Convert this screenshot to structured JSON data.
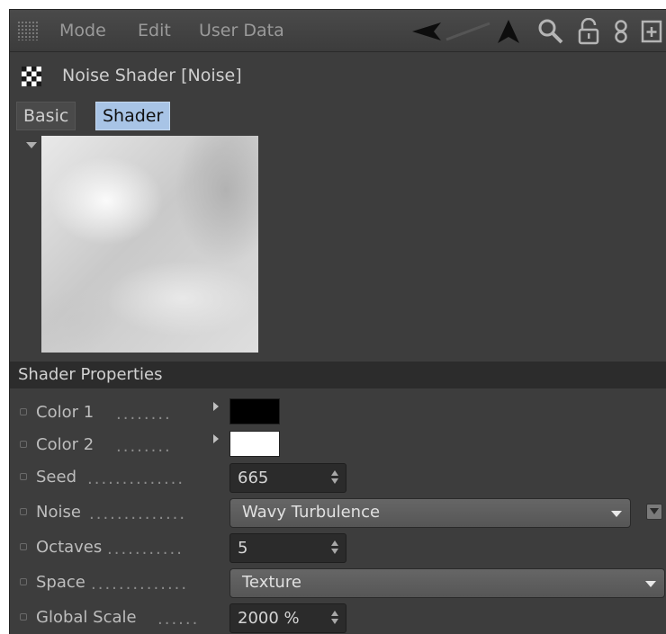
{
  "menubar": {
    "items": [
      "Mode",
      "Edit",
      "User Data"
    ],
    "icons": [
      "back-arrow-icon",
      "up-arrow-icon",
      "search-icon",
      "lock-icon",
      "link-icon",
      "new-panel-icon"
    ]
  },
  "header": {
    "icon": "checkerboard-icon",
    "title": "Noise Shader [Noise]"
  },
  "tabs": [
    {
      "label": "Basic",
      "active": false
    },
    {
      "label": "Shader",
      "active": true
    }
  ],
  "section": {
    "title": "Shader Properties"
  },
  "properties": {
    "color1": {
      "label": "Color 1",
      "dots": "........",
      "value": "#000000"
    },
    "color2": {
      "label": "Color 2",
      "dots": "........",
      "value": "#ffffff"
    },
    "seed": {
      "label": "Seed",
      "dots": "..............",
      "value": "665"
    },
    "noise": {
      "label": "Noise",
      "dots": "..............",
      "value": "Wavy Turbulence"
    },
    "octaves": {
      "label": "Octaves",
      "dots": "...........",
      "value": "5"
    },
    "space": {
      "label": "Space",
      "dots": "..............",
      "value": "Texture"
    },
    "global_scale": {
      "label": "Global Scale",
      "dots": "......",
      "value": "2000 %"
    }
  }
}
